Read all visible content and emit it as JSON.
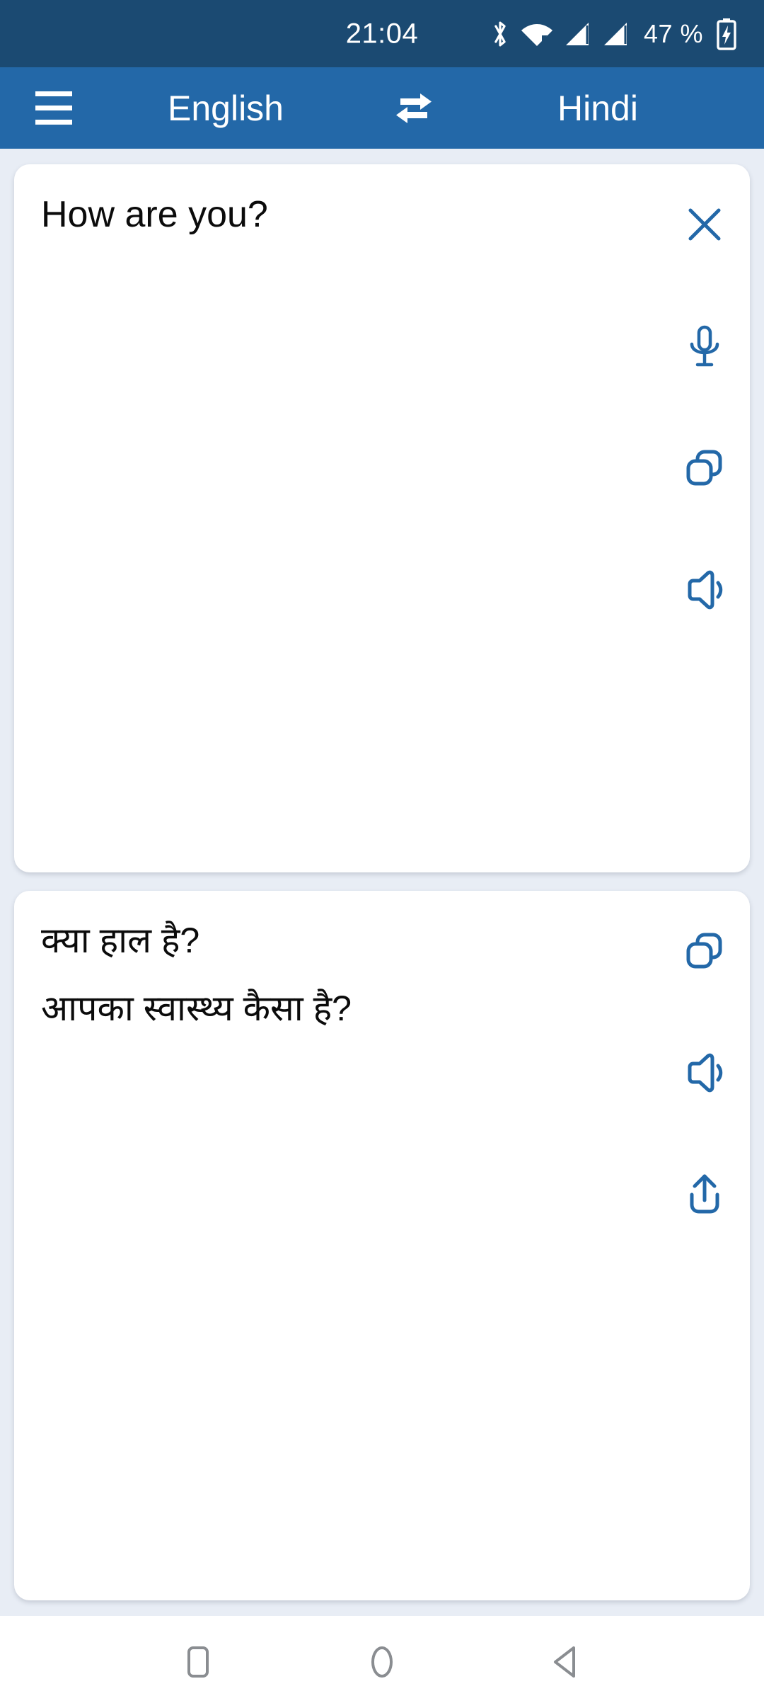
{
  "status_bar": {
    "clock": "21:04",
    "battery_percent": "47 %",
    "icons": [
      "bluetooth-icon",
      "wifi-icon",
      "signal-sim1-icon",
      "signal-sim2-icon",
      "battery-charging-icon"
    ],
    "background_color": "#1b4a72"
  },
  "app_bar": {
    "menu_icon": "hamburger-menu-icon",
    "source_language": "English",
    "swap_icon": "swap-languages-icon",
    "target_language": "Hindi",
    "background_color": "#2368a8"
  },
  "input_card": {
    "text": "How are you?",
    "actions": [
      {
        "name": "clear-button",
        "icon": "close-icon"
      },
      {
        "name": "voice-input-button",
        "icon": "microphone-icon"
      },
      {
        "name": "copy-button",
        "icon": "copy-icon"
      },
      {
        "name": "speak-button",
        "icon": "speaker-icon"
      }
    ]
  },
  "output_card": {
    "translations": [
      "क्या हाल है?",
      "आपका स्वास्थ्य कैसा है?"
    ],
    "actions": [
      {
        "name": "copy-translation-button",
        "icon": "copy-icon"
      },
      {
        "name": "speak-translation-button",
        "icon": "speaker-icon"
      },
      {
        "name": "share-translation-button",
        "icon": "share-icon"
      }
    ]
  },
  "nav_bar": {
    "buttons": [
      {
        "name": "recents-button",
        "icon": "square-icon"
      },
      {
        "name": "home-button",
        "icon": "circle-icon"
      },
      {
        "name": "back-button",
        "icon": "triangle-left-icon"
      }
    ]
  },
  "colors": {
    "accent": "#2368a8",
    "status_bar": "#1b4a72",
    "page_background": "#e8edf5",
    "card_background": "#ffffff",
    "text": "#0b0b0b",
    "nav_icon": "#8a8d91"
  }
}
